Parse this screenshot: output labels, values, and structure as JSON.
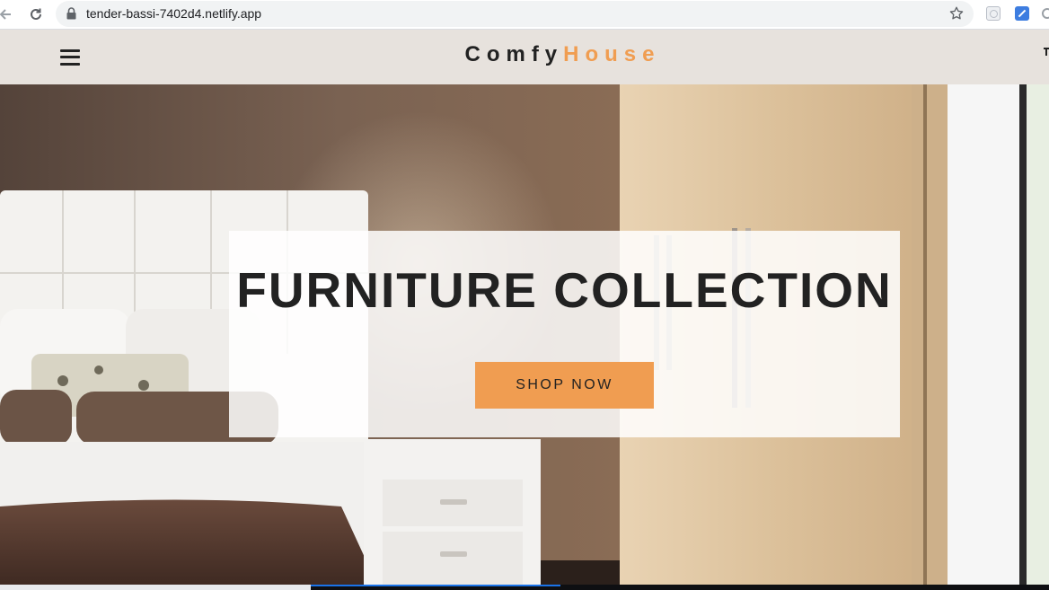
{
  "browser": {
    "url": "tender-bassi-7402d4.netlify.app",
    "icons": [
      "back-arrow-icon",
      "reload-icon",
      "lock-icon",
      "bookmark-star-icon"
    ]
  },
  "navbar": {
    "logo_part1": "Comfy",
    "logo_part2": "House",
    "accent_color": "#f09d51",
    "background_color": "#e7e2dd"
  },
  "hero": {
    "title": "FURNITURE COLLECTION",
    "button_label": "SHOP NOW",
    "button_color": "#f09d51"
  }
}
